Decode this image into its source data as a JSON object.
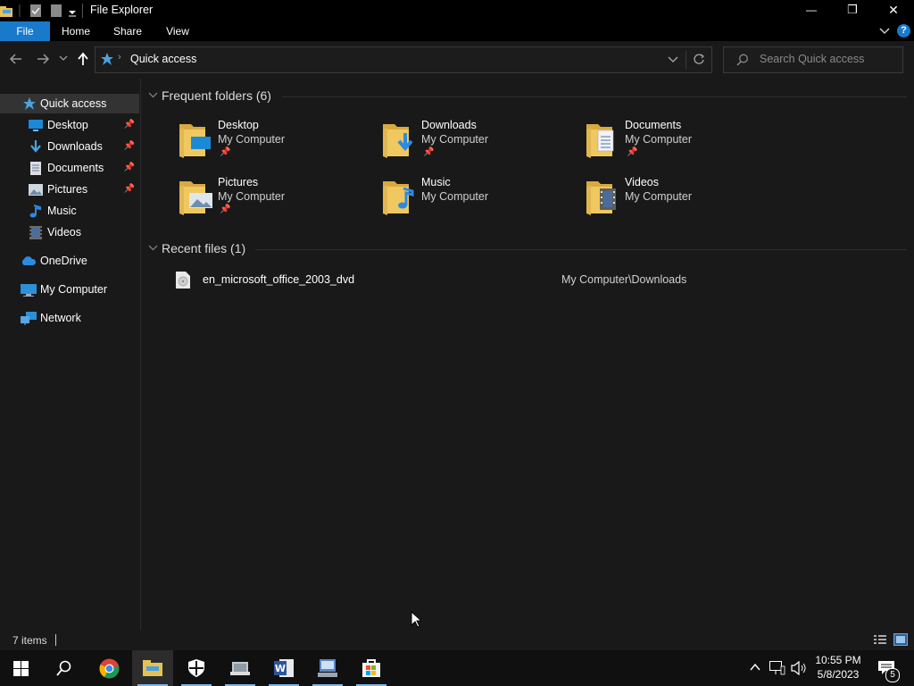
{
  "window": {
    "title": "File Explorer",
    "controls": {
      "minimize": "—",
      "restore": "❐",
      "close": "✕"
    }
  },
  "ribbon": {
    "tabs": [
      "File",
      "Home",
      "Share",
      "View"
    ],
    "help": "?"
  },
  "address": {
    "path": "Quick access",
    "search_placeholder": "Search Quick access"
  },
  "nav": {
    "quick_access": "Quick access",
    "pinned": [
      "Desktop",
      "Downloads",
      "Documents",
      "Pictures"
    ],
    "unpinned": [
      "Music",
      "Videos"
    ],
    "onedrive": "OneDrive",
    "my_computer": "My Computer",
    "network": "Network"
  },
  "content": {
    "frequent_header": "Frequent folders (6)",
    "folders": [
      {
        "name": "Desktop",
        "location": "My Computer",
        "pinned": true,
        "icon": "desktop-folder-icon"
      },
      {
        "name": "Downloads",
        "location": "My Computer",
        "pinned": true,
        "icon": "downloads-folder-icon"
      },
      {
        "name": "Documents",
        "location": "My Computer",
        "pinned": true,
        "icon": "documents-folder-icon"
      },
      {
        "name": "Pictures",
        "location": "My Computer",
        "pinned": true,
        "icon": "pictures-folder-icon"
      },
      {
        "name": "Music",
        "location": "My Computer",
        "pinned": false,
        "icon": "music-folder-icon"
      },
      {
        "name": "Videos",
        "location": "My Computer",
        "pinned": false,
        "icon": "videos-folder-icon"
      }
    ],
    "recent_header": "Recent files (1)",
    "recent_files": [
      {
        "name": "en_microsoft_office_2003_dvd",
        "path": "My Computer\\Downloads"
      }
    ]
  },
  "status": {
    "items": "7 items"
  },
  "tray": {
    "time": "10:55 PM",
    "date": "5/8/2023",
    "notifications": "5"
  },
  "colors": {
    "accent": "#4aa3df",
    "folder": "#e8c155",
    "background": "#191919"
  }
}
